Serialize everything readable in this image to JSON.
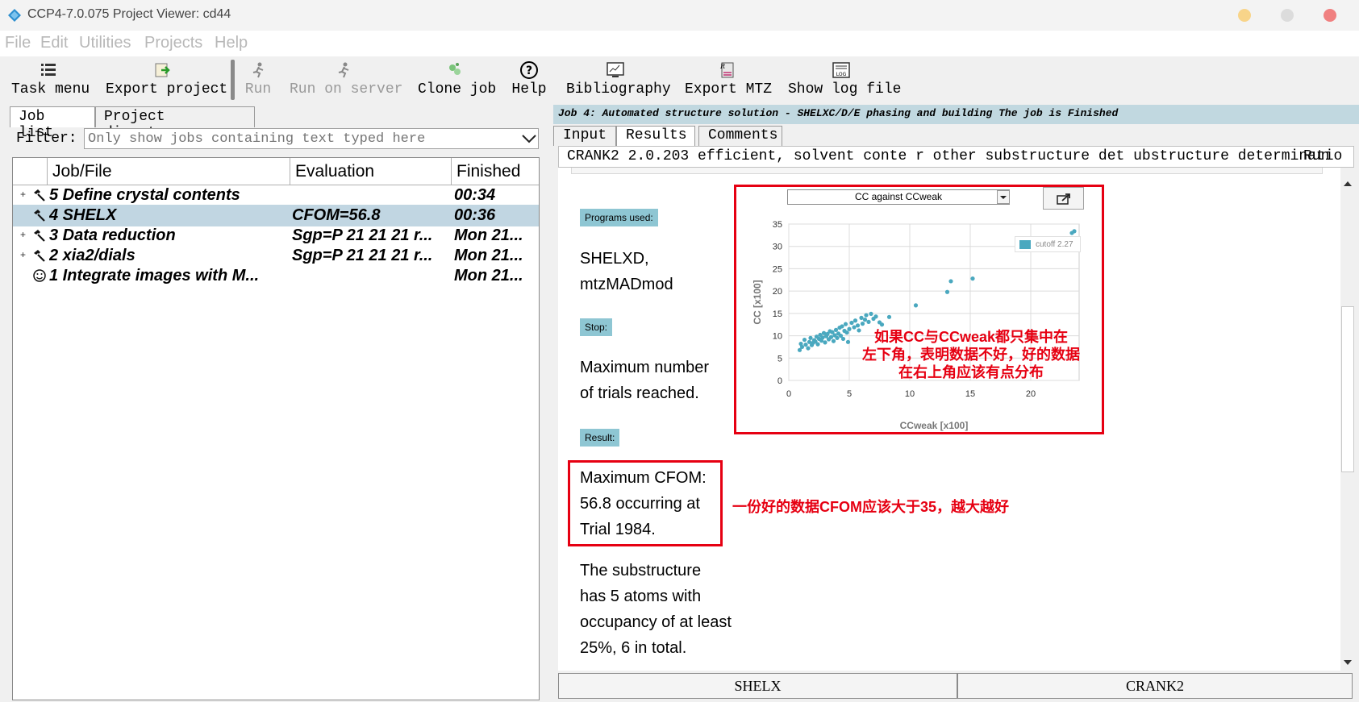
{
  "window": {
    "title": "CCP4-7.0.075 Project Viewer: cd44"
  },
  "menu": [
    "File",
    "Edit",
    "Utilities",
    "Projects",
    "Help"
  ],
  "toolbar": [
    {
      "label": "Task menu",
      "icon": "task-menu-icon",
      "enabled": true
    },
    {
      "label": "Export project",
      "icon": "export-project-icon",
      "enabled": true
    },
    {
      "label": "Run",
      "icon": "run-icon",
      "enabled": false
    },
    {
      "label": "Run on server",
      "icon": "run-on-server-icon",
      "enabled": false
    },
    {
      "label": "Clone job",
      "icon": "clone-job-icon",
      "enabled": true
    },
    {
      "label": "Help",
      "icon": "help-icon",
      "enabled": true
    },
    {
      "label": "Bibliography",
      "icon": "bibliography-icon",
      "enabled": true
    },
    {
      "label": "Export MTZ",
      "icon": "export-mtz-icon",
      "enabled": true
    },
    {
      "label": "Show log file",
      "icon": "log-file-icon",
      "enabled": true
    }
  ],
  "left_tabs": [
    "Job list",
    "Project directory"
  ],
  "filter": {
    "label": "Filter:",
    "placeholder": "Only show jobs containing text typed here"
  },
  "job_table": {
    "headers": [
      "Job/File",
      "Evaluation",
      "Finished"
    ],
    "rows": [
      {
        "expander": "+",
        "icon": "hammer-icon",
        "job": "5 Define crystal contents",
        "eval": "",
        "finished": "00:34",
        "selected": false
      },
      {
        "expander": "",
        "icon": "hammer-icon",
        "job": "4 SHELX",
        "eval": "CFOM=56.8",
        "finished": "00:36",
        "selected": true
      },
      {
        "expander": "+",
        "icon": "hammer-icon",
        "job": "3 Data reduction",
        "eval": "Sgp=P 21 21 21 r...",
        "finished": "Mon 21...",
        "selected": false
      },
      {
        "expander": "+",
        "icon": "hammer-icon",
        "job": "2 xia2/dials",
        "eval": "Sgp=P 21 21 21 r...",
        "finished": "Mon 21...",
        "selected": false
      },
      {
        "expander": "",
        "icon": "smiley-icon",
        "job": "1 Integrate images with M...",
        "eval": "",
        "finished": "Mon 21...",
        "selected": false
      }
    ]
  },
  "job_header": "Job 4:  Automated structure solution - SHELXC/D/E phasing and building The job is Finished",
  "right_tabs": [
    "Input",
    "Results",
    "Comments"
  ],
  "crank_bar": {
    "text": "CRANK2  2.0.203 efficient, solvent conte r other substructure det ubstructure determinatio",
    "run": "Run"
  },
  "results": {
    "programs_label": "Programs used:",
    "programs_text": [
      "SHELXD,",
      "mtzMADmod"
    ],
    "stop_label": "Stop:",
    "stop_text": [
      "Maximum number",
      "of trials reached."
    ],
    "result_label": "Result:",
    "result_text": [
      "Maximum CFOM:",
      "56.8 occurring at",
      "Trial 1984."
    ],
    "substructure_text": [
      "The substructure",
      "has 5 atoms with",
      "occupancy of at least",
      "25%, 6 in total."
    ]
  },
  "annotations": {
    "chart_note": [
      "如果CC与CCweak都只集中在",
      "左下角，表明数据不好，好的数据",
      "在右上角应该有点分布"
    ],
    "cfom_note": "一份好的数据CFOM应该大于35，越大越好"
  },
  "chart_select": "CC against CCweak",
  "chart_data": {
    "type": "scatter",
    "xlabel": "CCweak [x100]",
    "ylabel": "CC [x100]",
    "xlim": [
      0,
      24
    ],
    "ylim": [
      0,
      35
    ],
    "xticks": [
      0,
      5,
      10,
      15,
      20
    ],
    "yticks": [
      0,
      5,
      10,
      15,
      20,
      25,
      30,
      35
    ],
    "grid": true,
    "legend": "top-right",
    "series": [
      {
        "name": "cutoff 2.27",
        "color": "#4aa8bf",
        "points": [
          [
            0.9,
            6.8
          ],
          [
            1.0,
            8.2
          ],
          [
            1.1,
            7.5
          ],
          [
            1.3,
            9.1
          ],
          [
            1.4,
            8.0
          ],
          [
            1.6,
            7.2
          ],
          [
            1.7,
            8.6
          ],
          [
            1.8,
            9.5
          ],
          [
            1.9,
            7.9
          ],
          [
            2.0,
            8.4
          ],
          [
            2.1,
            9.0
          ],
          [
            2.2,
            8.7
          ],
          [
            2.3,
            9.8
          ],
          [
            2.4,
            8.1
          ],
          [
            2.5,
            9.3
          ],
          [
            2.6,
            10.2
          ],
          [
            2.7,
            8.9
          ],
          [
            2.8,
            9.6
          ],
          [
            2.9,
            10.6
          ],
          [
            3.0,
            8.5
          ],
          [
            3.1,
            9.9
          ],
          [
            3.2,
            10.4
          ],
          [
            3.3,
            9.2
          ],
          [
            3.4,
            11.0
          ],
          [
            3.5,
            9.7
          ],
          [
            3.6,
            10.8
          ],
          [
            3.7,
            8.8
          ],
          [
            3.8,
            10.1
          ],
          [
            3.9,
            11.3
          ],
          [
            4.0,
            9.5
          ],
          [
            4.1,
            10.5
          ],
          [
            4.2,
            11.8
          ],
          [
            4.3,
            10.0
          ],
          [
            4.4,
            12.1
          ],
          [
            4.5,
            9.3
          ],
          [
            4.6,
            11.1
          ],
          [
            4.7,
            12.6
          ],
          [
            4.8,
            10.7
          ],
          [
            4.9,
            8.6
          ],
          [
            5.0,
            11.5
          ],
          [
            5.2,
            12.9
          ],
          [
            5.4,
            11.9
          ],
          [
            5.5,
            13.4
          ],
          [
            5.7,
            12.3
          ],
          [
            5.8,
            11.2
          ],
          [
            6.0,
            14.0
          ],
          [
            6.1,
            12.7
          ],
          [
            6.3,
            13.6
          ],
          [
            6.4,
            14.6
          ],
          [
            6.6,
            13.1
          ],
          [
            6.8,
            14.9
          ],
          [
            7.0,
            13.8
          ],
          [
            7.2,
            14.3
          ],
          [
            7.5,
            13.0
          ],
          [
            7.7,
            12.5
          ],
          [
            8.3,
            14.2
          ],
          [
            10.5,
            16.8
          ],
          [
            13.1,
            19.8
          ],
          [
            13.4,
            22.2
          ],
          [
            15.2,
            22.8
          ],
          [
            23.4,
            33.0
          ],
          [
            23.6,
            33.4
          ]
        ]
      }
    ]
  },
  "bottom_buttons": [
    "SHELX",
    "CRANK2"
  ],
  "colors": {
    "accent_red": "#e60012",
    "selection": "#c1d6e2",
    "tag_bg": "#8ec6d3",
    "point": "#4aa8bf"
  }
}
